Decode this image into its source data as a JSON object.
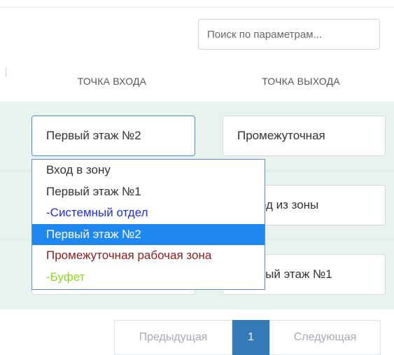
{
  "search": {
    "placeholder": "Поиск по параметрам..."
  },
  "table": {
    "columns": [
      "ТОЧКА ВХОДА",
      "ТОЧКА ВЫХОДА"
    ],
    "rows": [
      {
        "entry": "Первый этаж №2",
        "exit": "Промежуточная"
      },
      {
        "entry": "",
        "exit": "Выход из зоны"
      },
      {
        "entry": "",
        "exit": "Первый этаж №1"
      }
    ]
  },
  "dropdown": {
    "selected": "Первый этаж №2",
    "options": [
      {
        "label": "Вход в зону",
        "color": "#333333"
      },
      {
        "label": "Первый этаж №1",
        "color": "#333333"
      },
      {
        "label": "-Системный отдел",
        "color": "#1f2ee0"
      },
      {
        "label": "Первый этаж №2",
        "color": "#ffffff",
        "highlighted": true
      },
      {
        "label": "Промежуточная рабочая зона",
        "color": "#8b1c1c"
      },
      {
        "label": "-Буфет",
        "color": "#8bdc1e"
      }
    ]
  },
  "pagination": {
    "prev": "Предыдущая",
    "current": "1",
    "next": "Следующая"
  },
  "colors": {
    "band": "#e9f3ee",
    "highlight": "#1e88f0",
    "pager_active": "#337ab7"
  }
}
